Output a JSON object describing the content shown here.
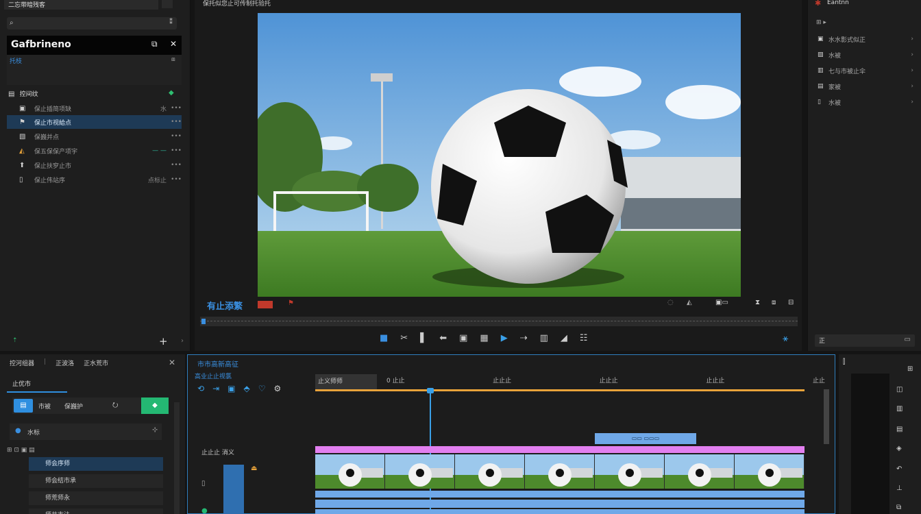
{
  "left_panel": {
    "title": "二忘带暗残客",
    "search_placeholder": "",
    "project_name": "Gafbrineno",
    "project_sub": "托枝",
    "section_label": "控间纹",
    "items": [
      {
        "label": "保止插简项缺",
        "meta": "水",
        "end": "•••"
      },
      {
        "label": "保止市视給点",
        "meta": "",
        "end": "•••"
      },
      {
        "label": "保巍并点",
        "meta": "",
        "end": "•••"
      },
      {
        "label": "保五保保产项宇",
        "meta": "— —",
        "end": "•••"
      },
      {
        "label": "保止扶穸止市",
        "meta": "",
        "end": "•••"
      },
      {
        "label": "保止伟站序",
        "meta": "点标止",
        "end": "•••"
      }
    ],
    "add_label": "+"
  },
  "viewer": {
    "header": "保托似您止可传制托验托",
    "title": "有止添繁",
    "tools": [
      "■",
      "✂",
      "▌",
      "⬅",
      "▣",
      "▦",
      "▶",
      "⇢",
      "▥",
      "◢",
      "☷"
    ]
  },
  "right_panel": {
    "title": "Eantnn",
    "items": [
      {
        "label": "水水影式似正"
      },
      {
        "label": "水被"
      },
      {
        "label": "七与市被止伞"
      },
      {
        "label": "家被"
      },
      {
        "label": "水被"
      }
    ],
    "footer_btn": "正"
  },
  "bottom_left": {
    "tabs": [
      "控河组器",
      "正波洛",
      "正水荒市"
    ],
    "subtab": "止优市",
    "btn_row": [
      "市被",
      "保巍护",
      "⭮"
    ],
    "field_label": "水标",
    "tree": [
      {
        "label": "师会序师"
      },
      {
        "label": "师会结市承"
      },
      {
        "label": "师荒师永"
      },
      {
        "label": "师井市法"
      }
    ]
  },
  "timeline": {
    "title": "市市高新高征",
    "subtitle": "高业止止视氯",
    "track_header": "止义师师",
    "ruler": [
      "0 止止",
      "止止止",
      "止止止",
      "止止止",
      "止止"
    ],
    "track_label": "止止止 消义",
    "playhead_pct": 18.8
  },
  "colors": {
    "accent": "#2f8fe0",
    "clip_video": "#6fa8e8",
    "clip_pink": "#e27ff0",
    "play_green": "#24b873",
    "record_red": "#c0392b"
  }
}
